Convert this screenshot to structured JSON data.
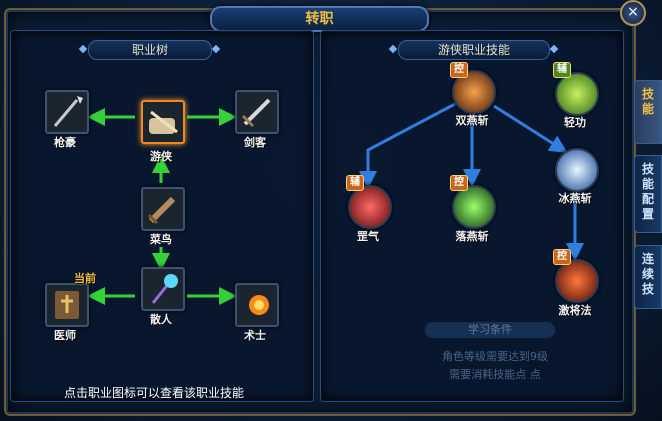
{
  "window": {
    "title": "转职",
    "close_label": "×"
  },
  "left_panel": {
    "header": "职业树",
    "nodes": {
      "qianghao": "枪豪",
      "youxia": "游侠",
      "jianke": "剑客",
      "cainiao": "菜鸟",
      "sanren": "散人",
      "yishi": "医师",
      "shushi": "术士"
    },
    "current_badge": "当前",
    "footer": "点击职业图标可以查看该职业技能"
  },
  "right_panel": {
    "header": "游侠职业技能",
    "skills": {
      "shuangyanzhan": "双燕斩",
      "qinggong": "轻功",
      "bingyanzhan": "冰燕斩",
      "gangqi": "罡气",
      "luoyanzhan": "落燕斩",
      "jijiangfa": "激将法"
    },
    "badges": {
      "control": "控",
      "assist": "辅"
    },
    "learn_condition": "学习条件",
    "requirement_line1": "角色等级需要达到9级",
    "requirement_line2": "需要消耗技能点 点"
  },
  "side_tabs": [
    "技能",
    "技能配置",
    "连续技"
  ],
  "colors": {
    "gold": "#f0c040",
    "arrow_green": "#35d13a",
    "arrow_blue": "#2f7fe0"
  }
}
